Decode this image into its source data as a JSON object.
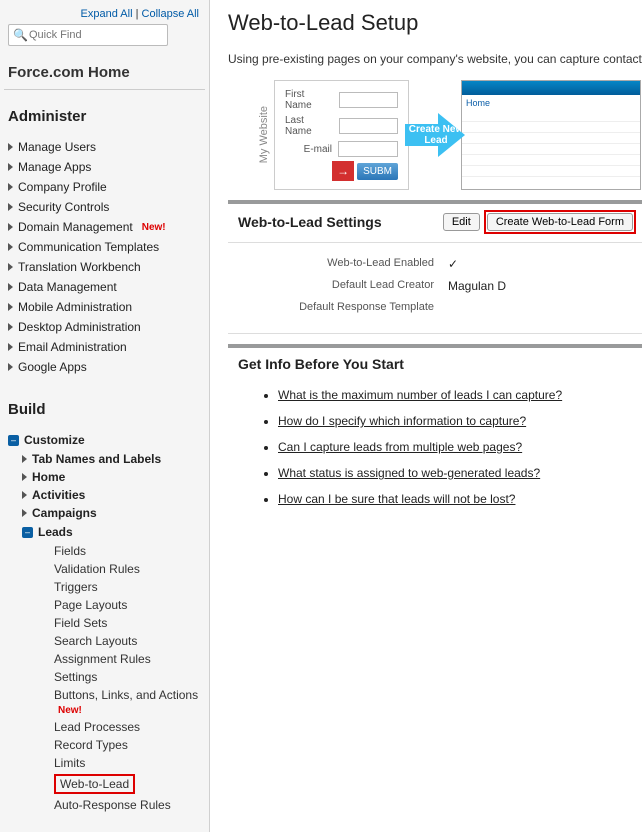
{
  "sidebar": {
    "expand_all": "Expand All",
    "collapse_all": "Collapse All",
    "quick_find_placeholder": "Quick Find",
    "home_heading": "Force.com Home",
    "administer_heading": "Administer",
    "admin_items": [
      {
        "label": "Manage Users",
        "new": false
      },
      {
        "label": "Manage Apps",
        "new": false
      },
      {
        "label": "Company Profile",
        "new": false
      },
      {
        "label": "Security Controls",
        "new": false
      },
      {
        "label": "Domain Management",
        "new": true
      },
      {
        "label": "Communication Templates",
        "new": false
      },
      {
        "label": "Translation Workbench",
        "new": false
      },
      {
        "label": "Data Management",
        "new": false
      },
      {
        "label": "Mobile Administration",
        "new": false
      },
      {
        "label": "Desktop Administration",
        "new": false
      },
      {
        "label": "Email Administration",
        "new": false
      },
      {
        "label": "Google Apps",
        "new": false
      }
    ],
    "build_heading": "Build",
    "customize_label": "Customize",
    "customize_children": [
      {
        "label": "Tab Names and Labels"
      },
      {
        "label": "Home"
      },
      {
        "label": "Activities"
      },
      {
        "label": "Campaigns"
      }
    ],
    "leads_label": "Leads",
    "leads_children": [
      {
        "label": "Fields",
        "new": false
      },
      {
        "label": "Validation Rules",
        "new": false
      },
      {
        "label": "Triggers",
        "new": false
      },
      {
        "label": "Page Layouts",
        "new": false
      },
      {
        "label": "Field Sets",
        "new": false
      },
      {
        "label": "Search Layouts",
        "new": false
      },
      {
        "label": "Assignment Rules",
        "new": false
      },
      {
        "label": "Settings",
        "new": false
      },
      {
        "label": "Buttons, Links, and Actions",
        "new": true
      },
      {
        "label": "Lead Processes",
        "new": false
      },
      {
        "label": "Record Types",
        "new": false
      },
      {
        "label": "Limits",
        "new": false
      }
    ],
    "web_to_lead_label": "Web-to-Lead",
    "auto_response_label": "Auto-Response Rules",
    "new_badge": "New!"
  },
  "main": {
    "title": "Web-to-Lead Setup",
    "intro": "Using pre-existing pages on your company's website, you can capture contact and profile information from users. You can also enable your company to respond in real-time to customer requests.",
    "illus": {
      "my_website": "My Website",
      "first_name": "First Name",
      "last_name": "Last Name",
      "email": "E-mail",
      "submit": "SUBM",
      "arrow_text": "Create New Lead",
      "home": "Home"
    },
    "settings_heading": "Web-to-Lead Settings",
    "edit_btn": "Edit",
    "create_btn": "Create Web-to-Lead Form",
    "kv": {
      "enabled_label": "Web-to-Lead Enabled",
      "creator_label": "Default Lead Creator",
      "creator_value": "Magulan D",
      "template_label": "Default Response Template"
    },
    "getinfo_heading": "Get Info Before You Start",
    "links": [
      "What is the maximum number of leads I can capture?",
      "How do I specify which information to capture?",
      "Can I capture leads from multiple web pages?",
      "What status is assigned to web-generated leads?",
      "How can I be sure that leads will not be lost?"
    ]
  }
}
